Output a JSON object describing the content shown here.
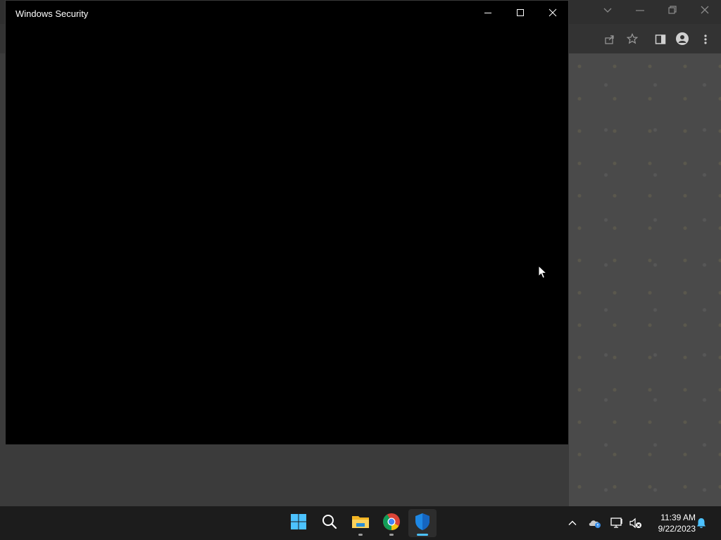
{
  "security_window": {
    "title": "Windows Security"
  },
  "taskbar": {
    "apps": [
      {
        "name": "Start"
      },
      {
        "name": "Search"
      },
      {
        "name": "File Explorer"
      },
      {
        "name": "Google Chrome"
      },
      {
        "name": "Windows Security"
      }
    ],
    "clock": {
      "time": "11:39 AM",
      "date": "9/22/2023"
    }
  },
  "colors": {
    "window_bg": "#000000",
    "taskbar_bg": "#1c1c1c",
    "active_indicator": "#4cc2ff",
    "shield_blue": "#1e88e5"
  },
  "icons": [
    "minimize-icon",
    "maximize-icon",
    "close-icon",
    "windows-logo-icon",
    "search-icon",
    "folder-icon",
    "chrome-icon",
    "shield-icon",
    "chevron-up-icon",
    "onedrive-icon",
    "network-icon",
    "volume-muted-icon",
    "bell-icon",
    "share-icon",
    "star-icon",
    "sidebar-icon",
    "profile-icon",
    "more-icon",
    "chevron-down-icon",
    "restore-icon"
  ]
}
